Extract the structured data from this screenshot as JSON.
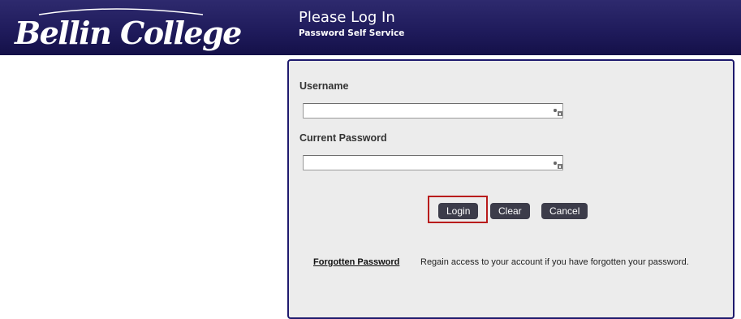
{
  "header": {
    "logo_text": "Bellin College",
    "title": "Please Log In",
    "subtitle": "Password Self Service"
  },
  "form": {
    "username_label": "Username",
    "username_value": "",
    "password_label": "Current Password",
    "password_value": ""
  },
  "buttons": {
    "login": "Login",
    "clear": "Clear",
    "cancel": "Cancel"
  },
  "forgotten": {
    "link_label": "Forgotten Password",
    "description": "Regain access to your account if you have forgotten your password."
  },
  "colors": {
    "header_bg": "#1e1a5a",
    "panel_border": "#1e1a6e",
    "button_bg": "#3c3c4a",
    "highlight": "#b81c1c"
  },
  "icons": [
    "password-manager-key-icon"
  ]
}
